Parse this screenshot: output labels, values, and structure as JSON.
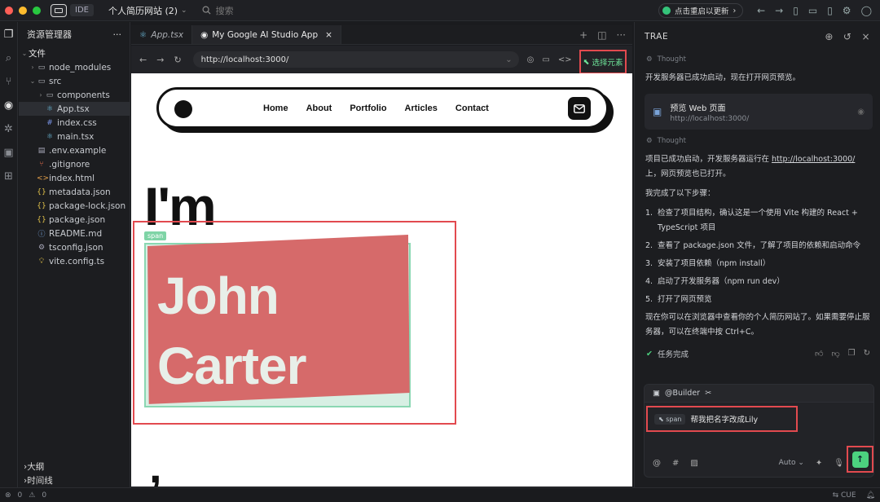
{
  "titlebar": {
    "ide_label": "IDE",
    "project": "个人简历网站 (2)",
    "search_placeholder": "搜索",
    "restart_label": "点击重启以更新"
  },
  "explorer": {
    "title": "资源管理器",
    "more": "···",
    "root": "文件",
    "items": [
      {
        "name": "node_modules",
        "depth": 1,
        "type": "folder",
        "twisty": "›"
      },
      {
        "name": "src",
        "depth": 1,
        "type": "folder",
        "twisty": "⌄"
      },
      {
        "name": "components",
        "depth": 2,
        "type": "folder",
        "twisty": "›"
      },
      {
        "name": "App.tsx",
        "depth": 2,
        "type": "react",
        "selected": true
      },
      {
        "name": "index.css",
        "depth": 2,
        "type": "css"
      },
      {
        "name": "main.tsx",
        "depth": 2,
        "type": "react"
      },
      {
        "name": ".env.example",
        "depth": 1,
        "type": "file"
      },
      {
        "name": ".gitignore",
        "depth": 1,
        "type": "git"
      },
      {
        "name": "index.html",
        "depth": 1,
        "type": "html"
      },
      {
        "name": "metadata.json",
        "depth": 1,
        "type": "json"
      },
      {
        "name": "package-lock.json",
        "depth": 1,
        "type": "json"
      },
      {
        "name": "package.json",
        "depth": 1,
        "type": "json"
      },
      {
        "name": "README.md",
        "depth": 1,
        "type": "info"
      },
      {
        "name": "tsconfig.json",
        "depth": 1,
        "type": "gear"
      },
      {
        "name": "vite.config.ts",
        "depth": 1,
        "type": "bulb"
      }
    ],
    "outline": "大纲",
    "timeline": "时间线"
  },
  "tabs": [
    {
      "label": "App.tsx",
      "active": false
    },
    {
      "label": "My Google AI Studio App",
      "active": true
    }
  ],
  "browser": {
    "url": "http://localhost:3000/",
    "pick_label": "选择元素"
  },
  "site": {
    "nav": [
      "Home",
      "About",
      "Portfolio",
      "Articles",
      "Contact"
    ],
    "im": "I'm",
    "span_tag": "span",
    "name_line1": "John",
    "name_line2": "Carter",
    "comma": ","
  },
  "panel": {
    "title": "TRAE",
    "thought_label": "Thought",
    "msg1": "开发服务器已成功启动，现在打开网页预览。",
    "card_title": "预览 Web 页面",
    "card_url": "http://localhost:3000/",
    "msg2_prefix": "项目已成功启动，开发服务器运行在 ",
    "msg2_link": "http://localhost:3000/",
    "msg2_suffix": " 上，网页预览也已打开。",
    "steps_intro": "我完成了以下步骤：",
    "steps": [
      {
        "n": "1.",
        "text": "检查了项目结构，确认这是一个使用 Vite 构建的 React + TypeScript 项目"
      },
      {
        "n": "2.",
        "text": "查看了 package.json 文件，了解了项目的依赖和启动命令"
      },
      {
        "n": "3.",
        "text": "安装了项目依赖（npm install）"
      },
      {
        "n": "4.",
        "text": "启动了开发服务器（npm run dev）"
      },
      {
        "n": "5.",
        "text": "打开了网页预览"
      }
    ],
    "closing": "现在你可以在浏览器中查看你的个人简历网站了。如果需要停止服务器，可以在终端中按 Ctrl+C。",
    "done_label": "任务完成",
    "builder": "@Builder",
    "chip": "span",
    "input_text": "帮我把名字改成Lily",
    "auto": "Auto"
  },
  "status": {
    "errors": "0",
    "warnings": "0",
    "lang": "CUE"
  },
  "colors": {
    "accent_red": "#e24a4f",
    "accent_green": "#4cd27f",
    "name_bg": "#d66a6a"
  }
}
